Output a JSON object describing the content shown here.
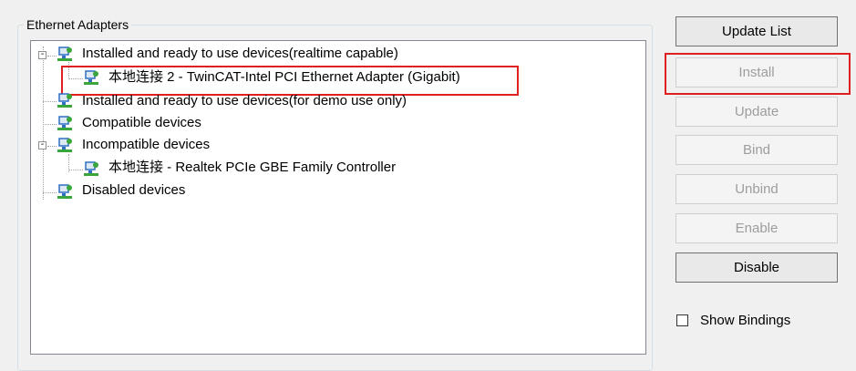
{
  "groupbox": {
    "title": "Ethernet Adapters"
  },
  "tree": {
    "nodes": [
      {
        "label": "Installed and ready to use devices(realtime capable)",
        "expander": "-"
      },
      {
        "label": "本地连接 2 - TwinCAT-Intel PCI Ethernet Adapter (Gigabit)"
      },
      {
        "label": "Installed and ready to use devices(for demo use only)"
      },
      {
        "label": "Compatible devices"
      },
      {
        "label": "Incompatible devices",
        "expander": "-"
      },
      {
        "label": "本地连接 - Realtek PCIe GBE Family Controller"
      },
      {
        "label": "Disabled devices"
      }
    ]
  },
  "buttons": {
    "update_list": "Update List",
    "install": "Install",
    "update": "Update",
    "bind": "Bind",
    "unbind": "Unbind",
    "enable": "Enable",
    "disable": "Disable"
  },
  "show_bindings": {
    "label": "Show Bindings",
    "checked": false
  },
  "colors": {
    "highlight": "#e02020",
    "disabled_text": "#9d9d9d",
    "icon_blue": "#2f6fc4",
    "icon_green": "#3aa53a"
  },
  "icons": {
    "adapter": "network-adapter-icon"
  }
}
